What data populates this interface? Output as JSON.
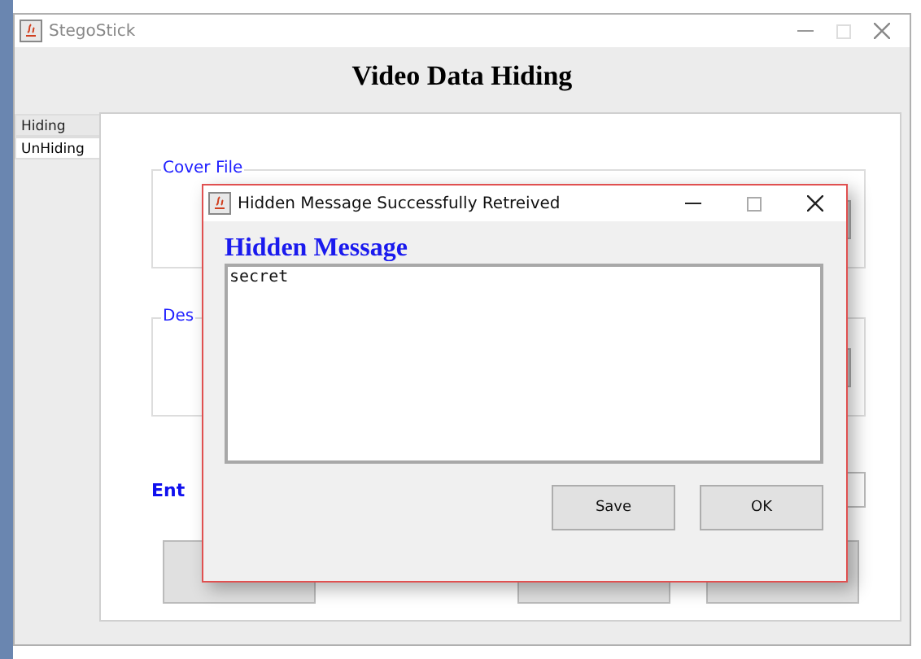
{
  "window": {
    "title": "StegoStick"
  },
  "heading": "Video Data Hiding",
  "tabs": [
    {
      "label": "Hiding",
      "selected": false
    },
    {
      "label": "UnHiding",
      "selected": true
    }
  ],
  "groups": [
    {
      "label": "Cover File"
    },
    {
      "label": "Des"
    }
  ],
  "enter_label": "Ent",
  "dialog": {
    "title": "Hidden Message Successfully Retreived",
    "heading": "Hidden Message",
    "message": "secret",
    "buttons": [
      "Save",
      "OK"
    ]
  }
}
